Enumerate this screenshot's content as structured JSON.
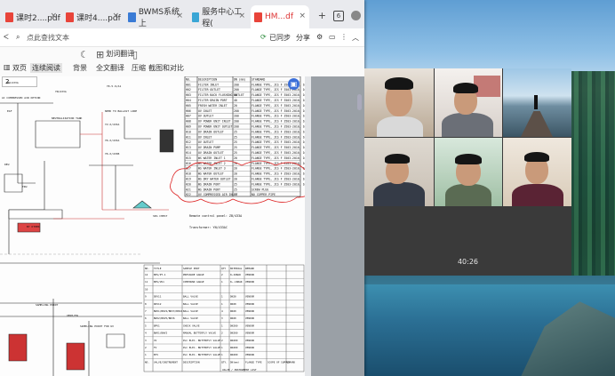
{
  "tabs": [
    {
      "label": "课时2....pdf",
      "icon": "pdf-icon"
    },
    {
      "label": "课时4....pdf",
      "icon": "pdf-icon"
    },
    {
      "label": "BWMS系统上",
      "icon": "web-icon"
    },
    {
      "label": "服务中心工程(",
      "icon": "service-icon"
    },
    {
      "label": "HM...df",
      "icon": "pdf-icon"
    }
  ],
  "tab_close": "×",
  "tab_new": "+",
  "tab_count_badge": "6",
  "toolbar": {
    "search_placeholder": "点此查找文本",
    "sync_label": "已同步",
    "share_label": "分享"
  },
  "tools": {
    "scroll_label": "划词翻译",
    "single_page": "双页",
    "continuous": "连续阅读",
    "background": "背景",
    "full_translate": "全文翻译",
    "compress": "压缩",
    "screenshot_compare": "截图和对比"
  },
  "page_number": "2",
  "cad": {
    "left_labels": [
      "YN/433A",
      "YK-5-9/A1",
      "DW/433A",
      "NEED TO BALLAST LINE",
      "YV-X/433A",
      "YK-X/433A",
      "YK-X/433B",
      "NEUTRALIZATION TANK",
      "EAF",
      "SEA CHEST",
      "AC COMPRESSED AIR OPTION",
      "SAMPLING POINT",
      "VENT/FW",
      "TRU",
      "DEU",
      "BY OTHER",
      "SAMPLING POINT FOR UV"
    ],
    "table_headers": [
      "NO.",
      "DESCRIPTION",
      "DN (mm)",
      "STANDARD"
    ],
    "table_rows": [
      [
        "H01",
        "FILTER INLET",
        "200",
        "FLANGE TYPE, JIS F 3503-2010, 10K"
      ],
      [
        "H02",
        "FILTER OUTLET",
        "200",
        "FLANGE TYPE, JIS F 3503-2010, 10K"
      ],
      [
        "H03",
        "FILTER BACK FLUSHING OUTLET",
        "50",
        "FLANGE TYPE, JIS F 3503-2010, 10K"
      ],
      [
        "H04",
        "FILTER DRAIN PORT",
        "40",
        "FLANGE TYPE, JIS F 3503-2010, 10K"
      ],
      [
        "H05",
        "FRESH WATER INLET",
        "20",
        "FLANGE TYPE, JIS F 3503-2010, 10K"
      ],
      [
        "H06",
        "UV INLET",
        "200",
        "FLANGE TYPE, JIS F 3503-2010, 10K"
      ],
      [
        "H07",
        "UV OUTLET",
        "200",
        "FLANGE TYPE, JIS F 3503-2010, 10K"
      ],
      [
        "H08",
        "UV POWER UNIT INLET",
        "200",
        "FLANGE TYPE, JIS F 3503-2010, 10K"
      ],
      [
        "H09",
        "UV POWER UNIT OUTLET",
        "200",
        "FLANGE TYPE, JIS F 3503-2010, 10K"
      ],
      [
        "H10",
        "UV DRAIN OUTLET",
        "25",
        "FLANGE TYPE, JIS F 3503-2010, 10K"
      ],
      [
        "H11",
        "UV INLET",
        "25",
        "FLANGE TYPE, JIS F 3503-2010, 10K"
      ],
      [
        "H12",
        "UV OUTLET",
        "25",
        "FLANGE TYPE, JIS F 3503-2010, 10K"
      ],
      [
        "H13",
        "UV DRAIN PUMP",
        "25",
        "FLANGE TYPE, JIS F 3503-2010, 10K"
      ],
      [
        "H14",
        "UV DRAIN OUTLET",
        "25",
        "FLANGE TYPE, JIS F 3503-2010, 10K"
      ],
      [
        "H15",
        "WS WATER INLET 1",
        "20",
        "FLANGE TYPE, JIS F 3503-2010, 10K"
      ],
      [
        "H16",
        "WS WATER INLET 2",
        "20",
        "FLANGE TYPE, JIS F 3503-2010, 10K"
      ],
      [
        "H17",
        "WS WATER INLET 3",
        "20",
        "FLANGE TYPE, JIS F 3503-2010, 10K"
      ],
      [
        "H18",
        "WS WATER OUTLET",
        "20",
        "FLANGE TYPE, JIS F 3503-2010, 10K"
      ],
      [
        "H19",
        "WS DRY WATER OUTLET",
        "20",
        "FLANGE TYPE, JIS F 3503-2010, 10K"
      ],
      [
        "H20",
        "WS DRAIN PORT",
        "25",
        "FLANGE TYPE, JIS F 3503-2010, 10K"
      ],
      [
        "H21",
        "WS DRAIN PORT",
        "25",
        "SCREW PLUG"
      ],
      [
        "H22",
        "UV COMPRESSED AIR INLET",
        "10",
        "NO COPPER PIPE"
      ]
    ],
    "remote_panel": "Remote control panel: ZB/433A",
    "transformer": "Transformer: YN/433AC",
    "bom_headers": [
      "NO.",
      "TITLE",
      "SAMPLE PORT",
      "QTY",
      "MATERIAL",
      "REMARK"
    ],
    "bom_rows": [
      [
        "12",
        "BPS/PT-1",
        "PRESSURE GAUGE",
        "2",
        "0~16BAR",
        "VENDOR"
      ],
      [
        "11",
        "BPS/UV1",
        "COMPOUND GAUGE",
        "1",
        "0~-16BAR",
        "VENDOR"
      ],
      [
        "10",
        "",
        "",
        "",
        "",
        ""
      ],
      [
        "9",
        "DDV11",
        "BALL VALVE",
        "1",
        "DN20",
        "VENDOR"
      ],
      [
        "8",
        "DDV12",
        "BALL VALVE",
        "1",
        "DN20",
        "VENDOR"
      ],
      [
        "7",
        "BWV1/BDV2/BDV3/BDV4",
        "BALL VALVE",
        "4",
        "DN20",
        "VENDOR"
      ],
      [
        "6",
        "BWV2/BDV5/BDV6",
        "BALL VALVE",
        "3",
        "DN20",
        "VENDOR"
      ],
      [
        "5",
        "BPV1",
        "CHECK VALVE",
        "1",
        "DN200",
        "VENDOR"
      ],
      [
        "4",
        "BWV1/BWV2",
        "MANUAL BUTTERFLY VALVE",
        "2",
        "DN200",
        "VENDOR"
      ],
      [
        "3",
        "VV",
        "PLC ELEC. BUTTERFLY VALVE",
        "2",
        "DN200",
        "VENDOR"
      ],
      [
        "2",
        "FV",
        "PLC ELEC. BUTTERFLY VALVE",
        "1",
        "DN200",
        "VENDOR"
      ],
      [
        "1",
        "BYV",
        "PLC ELEC. BUTTERFLY VALVE",
        "1",
        "DN200",
        "VENDOR"
      ]
    ],
    "bom_footer": [
      "NO.",
      "VALVE/INSTRUMENT",
      "DESCRIPTION",
      "QTY.",
      "DN(mm)",
      "FLANGE TYPE",
      "SCOPE OF SUPPLY",
      "REMARK"
    ],
    "bom_caption": "VALVE / INSTRUMENT LIST"
  },
  "call": {
    "timer": "40:26"
  }
}
